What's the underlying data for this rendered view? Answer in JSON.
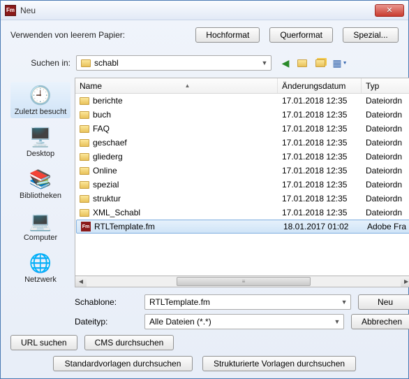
{
  "titlebar": {
    "title": "Neu",
    "close": "✕"
  },
  "header": {
    "paper_label": "Verwenden von leerem Papier:",
    "portrait": "Hochformat",
    "landscape": "Querformat",
    "special": "Spezial..."
  },
  "lookin": {
    "label": "Suchen in:",
    "value": "schabl"
  },
  "nav": {
    "back": "⟵",
    "up": "⇧",
    "new": "✚",
    "view": "▦",
    "viewarrow": "▾"
  },
  "sidebar": [
    {
      "icon": "🕘",
      "label": "Zuletzt besucht",
      "key": "recent"
    },
    {
      "icon": "🖥️",
      "label": "Desktop",
      "key": "desktop"
    },
    {
      "icon": "📚",
      "label": "Bibliotheken",
      "key": "libraries"
    },
    {
      "icon": "💻",
      "label": "Computer",
      "key": "computer"
    },
    {
      "icon": "🌐",
      "label": "Netzwerk",
      "key": "network"
    }
  ],
  "columns": {
    "name": "Name",
    "date": "Änderungsdatum",
    "type": "Typ"
  },
  "files": [
    {
      "name": "berichte",
      "date": "17.01.2018 12:35",
      "type": "Dateiordn",
      "kind": "folder"
    },
    {
      "name": "buch",
      "date": "17.01.2018 12:35",
      "type": "Dateiordn",
      "kind": "folder"
    },
    {
      "name": "FAQ",
      "date": "17.01.2018 12:35",
      "type": "Dateiordn",
      "kind": "folder"
    },
    {
      "name": "geschaef",
      "date": "17.01.2018 12:35",
      "type": "Dateiordn",
      "kind": "folder"
    },
    {
      "name": "gliederg",
      "date": "17.01.2018 12:35",
      "type": "Dateiordn",
      "kind": "folder"
    },
    {
      "name": "Online",
      "date": "17.01.2018 12:35",
      "type": "Dateiordn",
      "kind": "folder"
    },
    {
      "name": "spezial",
      "date": "17.01.2018 12:35",
      "type": "Dateiordn",
      "kind": "folder"
    },
    {
      "name": "struktur",
      "date": "17.01.2018 12:35",
      "type": "Dateiordn",
      "kind": "folder"
    },
    {
      "name": "XML_Schabl",
      "date": "17.01.2018 12:35",
      "type": "Dateiordn",
      "kind": "folder"
    },
    {
      "name": "RTLTemplate.fm",
      "date": "18.01.2017 01:02",
      "type": "Adobe Fra",
      "kind": "fm",
      "selected": true
    }
  ],
  "form": {
    "template_label": "Schablone:",
    "template_value": "RTLTemplate.fm",
    "filetype_label": "Dateityp:",
    "filetype_value": "Alle Dateien (*.*)",
    "new": "Neu",
    "cancel": "Abbrechen"
  },
  "bottom": {
    "url_search": "URL suchen",
    "cms_search": "CMS durchsuchen",
    "std_templates": "Standardvorlagen durchsuchen",
    "struct_templates": "Strukturierte Vorlagen durchsuchen"
  }
}
